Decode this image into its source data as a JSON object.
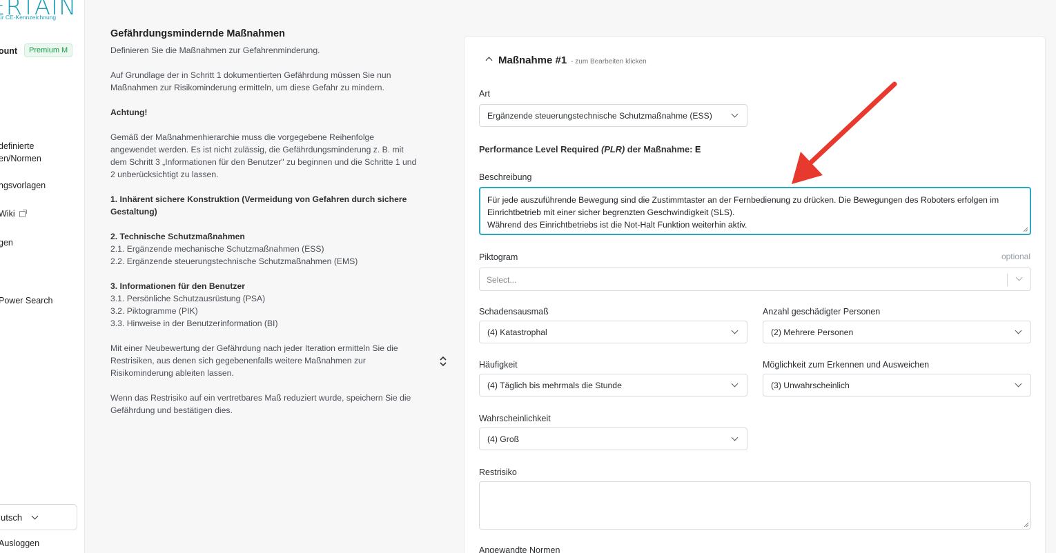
{
  "sidebar": {
    "logo": "ERTAIN",
    "logo_sub": "ür CE-Kennzeichnung",
    "account": "ount",
    "premium_badge": "Premium M",
    "items": [
      {
        "label_line1": "definierte",
        "label_line2": "en/Normen"
      },
      {
        "label": "ngsvorlagen"
      },
      {
        "label": "Wiki"
      },
      {
        "label": "gen"
      },
      {
        "label": "Power Search"
      }
    ],
    "language": "utsch",
    "logout": "Ausloggen"
  },
  "info": {
    "title": "Gefährdungsmindernde Maßnahmen",
    "subtitle": "Definieren Sie die Maßnahmen zur Gefahrenminderung.",
    "intro": "Auf Grundlage der in Schritt 1 dokumentierten Gefährdung müssen Sie nun Maßnahmen zur Risikominderung ermitteln, um diese Gefahr zu mindern.",
    "attention": "Achtung!",
    "hierarchy": "Gemäß der Maßnahmenhierarchie muss die vorgegebene Reihenfolge angewendet werden. Es ist nicht zulässig, die Gefährdungsminderung z. B. mit dem Schritt 3 „Informationen für den Benutzer\" zu beginnen und die Schritte 1 und 2 unberücksichtigt zu lassen.",
    "step1": "1. Inhärent sichere Konstruktion (Vermeidung von Gefahren durch sichere Gestaltung)",
    "step2": "2. Technische Schutzmaßnahmen",
    "step2_1": "2.1. Ergänzende mechanische Schutzmaßnahmen (ESS)",
    "step2_2": "2.2. Ergänzende steuerungstechnische Schutzmaßnahmen (EMS)",
    "step3": "3. Informationen für den Benutzer",
    "step3_1": "3.1. Persönliche Schutzausrüstung (PSA)",
    "step3_2": "3.2. Piktogramme (PIK)",
    "step3_3": "3.3. Hinweise in der Benutzerinformation (BI)",
    "reassess": "Mit einer Neubewertung der Gefährdung nach jeder Iteration ermitteln Sie die Restrisiken, aus denen sich gegebenenfalls weitere Maßnahmen zur Risikominderung ableiten lassen.",
    "save_hint": "Wenn das Restrisiko auf ein vertretbares Maß reduziert wurde, speichern Sie die Gefährdung und bestätigen dies."
  },
  "measure": {
    "title": "Maßnahme #1",
    "hint": "- zum Bearbeiten klicken",
    "art_label": "Art",
    "art_value": "Ergänzende steuerungstechnische Schutzmaßnahme (ESS)",
    "plr_prefix": "Performance Level Required ",
    "plr_abbr": "(PLR)",
    "plr_suffix": " der Maßnahme: ",
    "plr_value": "E",
    "description_label": "Beschreibung",
    "description_line1": "Für jede auszuführende Bewegung sind die Zustimmtaster an der Fernbedienung zu drücken. Die Bewegungen des Roboters erfolgen im",
    "description_line2": "Einrichtbetrieb mit einer sicher begrenzten Geschwindigkeit (SLS).",
    "description_line3": "Während des Einrichtbetriebs ist die Not-Halt Funktion weiterhin aktiv.",
    "piktogram_label": "Piktogram",
    "optional": "optional",
    "piktogram_placeholder": "Select...",
    "schadensausmass_label": "Schadensausmaß",
    "schadensausmass_value": "(4) Katastrophal",
    "anzahl_label": "Anzahl geschädigter Personen",
    "anzahl_value": "(2) Mehrere Personen",
    "haeufigkeit_label": "Häufigkeit",
    "haeufigkeit_value": "(4) Täglich bis mehrmals die Stunde",
    "erkennen_label": "Möglichkeit zum Erkennen und Ausweichen",
    "erkennen_value": "(3) Unwahrscheinlich",
    "wahrscheinlichkeit_label": "Wahrscheinlichkeit",
    "wahrscheinlichkeit_value": "(4) Groß",
    "restrisiko_label": "Restrisiko",
    "normen_label": "Angewandte Normen"
  },
  "colors": {
    "accent": "#2aa8c2",
    "arrow": "#e8392f",
    "premium": "#1c9a4a"
  }
}
